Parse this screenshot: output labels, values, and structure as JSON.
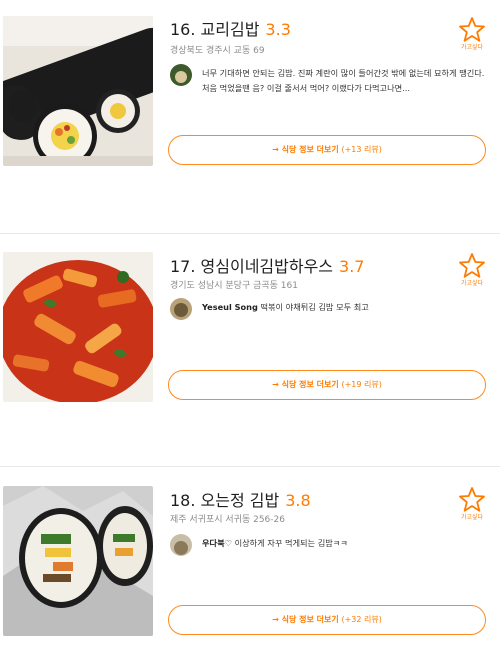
{
  "restaurants": [
    {
      "title": "16. 교리김밥",
      "rating": "3.3",
      "address": "경상북도 경주시 교동 69",
      "review_author": "",
      "review_text": "너무 기대하면 안되는 김밥. 진짜 계란이 많이 들어간것 밖에 없는데 묘하게 땡긴다. 처음 먹었을땐 음? 이걸 줄서서 먹어? 이랬다가 다먹고나면...",
      "more_label": "→ 식당 정보 더보기",
      "more_count": "(+13 리뷰)"
    },
    {
      "title": "17. 영심이네김밥하우스",
      "rating": "3.7",
      "address": "경기도 성남시 분당구 금곡동 161",
      "review_author": "Yeseul Song",
      "review_text": "떡볶이 야채튀김 김밥 모두 최고",
      "more_label": "→ 식당 정보 더보기",
      "more_count": "(+19 리뷰)"
    },
    {
      "title": "18. 오는정 김밥",
      "rating": "3.8",
      "address": "제주 서귀포시 서귀동 256-26",
      "review_author": "우다북♡",
      "review_text": "이상하게 자꾸 먹게되는 김밥ㅋㅋ",
      "more_label": "→ 식당 정보 더보기",
      "more_count": "(+32 리뷰)"
    }
  ],
  "wishlist_label": "가고싶다",
  "colors": {
    "accent": "#ff7b00",
    "text": "#1f1f1f",
    "subtext": "#8c8c8c",
    "divider": "#e8e8e8"
  },
  "icons": {
    "wishlist": "star-outline-icon",
    "more_arrow": "arrow-right-icon"
  }
}
